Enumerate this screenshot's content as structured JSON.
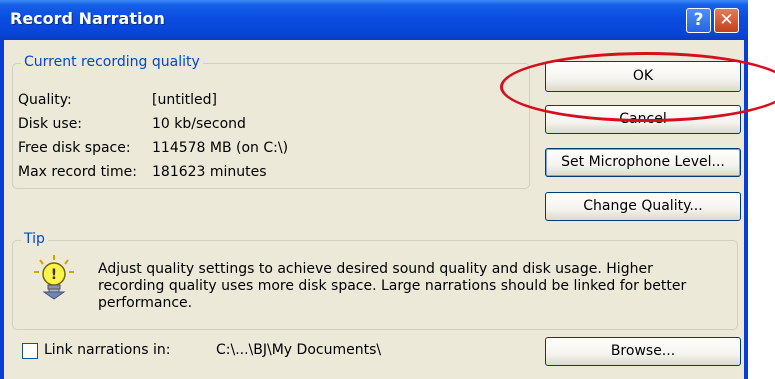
{
  "window": {
    "title": "Record Narration"
  },
  "caption_buttons": {
    "help": "?",
    "close": "✕"
  },
  "quality_group": {
    "legend": "Current recording quality",
    "rows": [
      {
        "label": "Quality:",
        "value": "[untitled]"
      },
      {
        "label": "Disk use:",
        "value": "10 kb/second"
      },
      {
        "label": "Free disk space:",
        "value": "114578 MB (on C:\\)"
      },
      {
        "label": "Max record time:",
        "value": "181623 minutes"
      }
    ]
  },
  "buttons": {
    "ok": "OK",
    "cancel": "Cancel",
    "set_microphone_level": "Set Microphone Level...",
    "change_quality": "Change Quality...",
    "browse": "Browse..."
  },
  "tip_group": {
    "legend": "Tip",
    "icon": "tip-lightbulb-icon",
    "text": "Adjust quality settings to achieve desired sound quality and disk usage. Higher recording quality uses more disk space. Large narrations should be linked for better performance."
  },
  "link": {
    "checkbox_label": "Link narrations in:",
    "checked": false,
    "path": "C:\\...\\BJ\\My Documents\\"
  },
  "annotation": {
    "color": "#d50f1e",
    "highlights": "OK button"
  }
}
